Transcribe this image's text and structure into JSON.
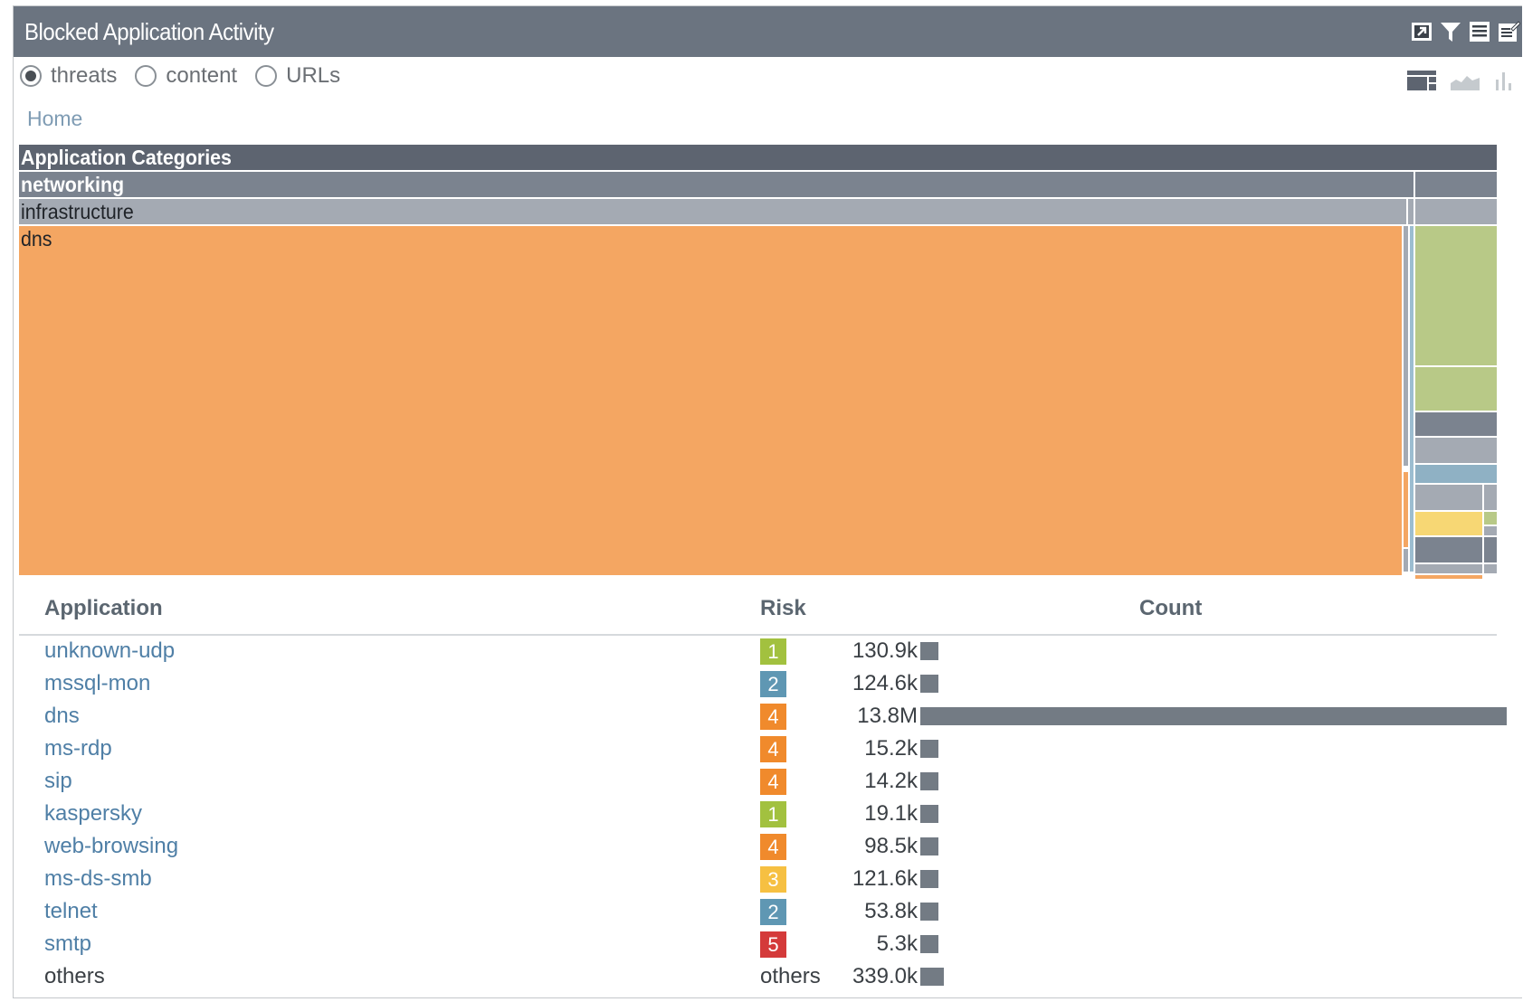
{
  "panel": {
    "title": "Blocked Application Activity",
    "toolbar_icons": [
      "popout-icon",
      "filter-icon",
      "list-icon",
      "edit-icon"
    ]
  },
  "mode_options": [
    {
      "label": "threats",
      "selected": true
    },
    {
      "label": "content",
      "selected": false
    },
    {
      "label": "URLs",
      "selected": false
    }
  ],
  "view_icons": [
    "treemap-view-icon",
    "area-chart-view-icon",
    "bar-chart-view-icon"
  ],
  "breadcrumb": "Home",
  "treemap": {
    "header": "Application Categories",
    "category": "networking",
    "subcategory": "infrastructure",
    "largest_tile": "dns"
  },
  "table": {
    "columns": {
      "application": "Application",
      "risk": "Risk",
      "count": "Count"
    },
    "rows": [
      {
        "app": "unknown-udp",
        "risk": "1",
        "count": "130.9k",
        "count_value": 130900
      },
      {
        "app": "mssql-mon",
        "risk": "2",
        "count": "124.6k",
        "count_value": 124600
      },
      {
        "app": "dns",
        "risk": "4",
        "count": "13.8M",
        "count_value": 13800000
      },
      {
        "app": "ms-rdp",
        "risk": "4",
        "count": "15.2k",
        "count_value": 15200
      },
      {
        "app": "sip",
        "risk": "4",
        "count": "14.2k",
        "count_value": 14200
      },
      {
        "app": "kaspersky",
        "risk": "1",
        "count": "19.1k",
        "count_value": 19100
      },
      {
        "app": "web-browsing",
        "risk": "4",
        "count": "98.5k",
        "count_value": 98500
      },
      {
        "app": "ms-ds-smb",
        "risk": "3",
        "count": "121.6k",
        "count_value": 121600
      },
      {
        "app": "telnet",
        "risk": "2",
        "count": "53.8k",
        "count_value": 53800
      },
      {
        "app": "smtp",
        "risk": "5",
        "count": "5.3k",
        "count_value": 5300
      },
      {
        "app": "others",
        "risk": "others",
        "count": "339.0k",
        "count_value": 339000
      }
    ]
  },
  "risk_colors": {
    "1": "#a2c13f",
    "2": "#5f97b3",
    "3": "#f6c042",
    "4": "#f08a2c",
    "5": "#d43a3a"
  },
  "colors": {
    "titlebar": "#6b7480",
    "treemap_header": "#5d6470",
    "treemap_category": "#7b838f",
    "treemap_subcategory": "#a4aab3",
    "treemap_dns": "#f4a662",
    "count_bar": "#737b84",
    "link": "#4f7fa6"
  }
}
